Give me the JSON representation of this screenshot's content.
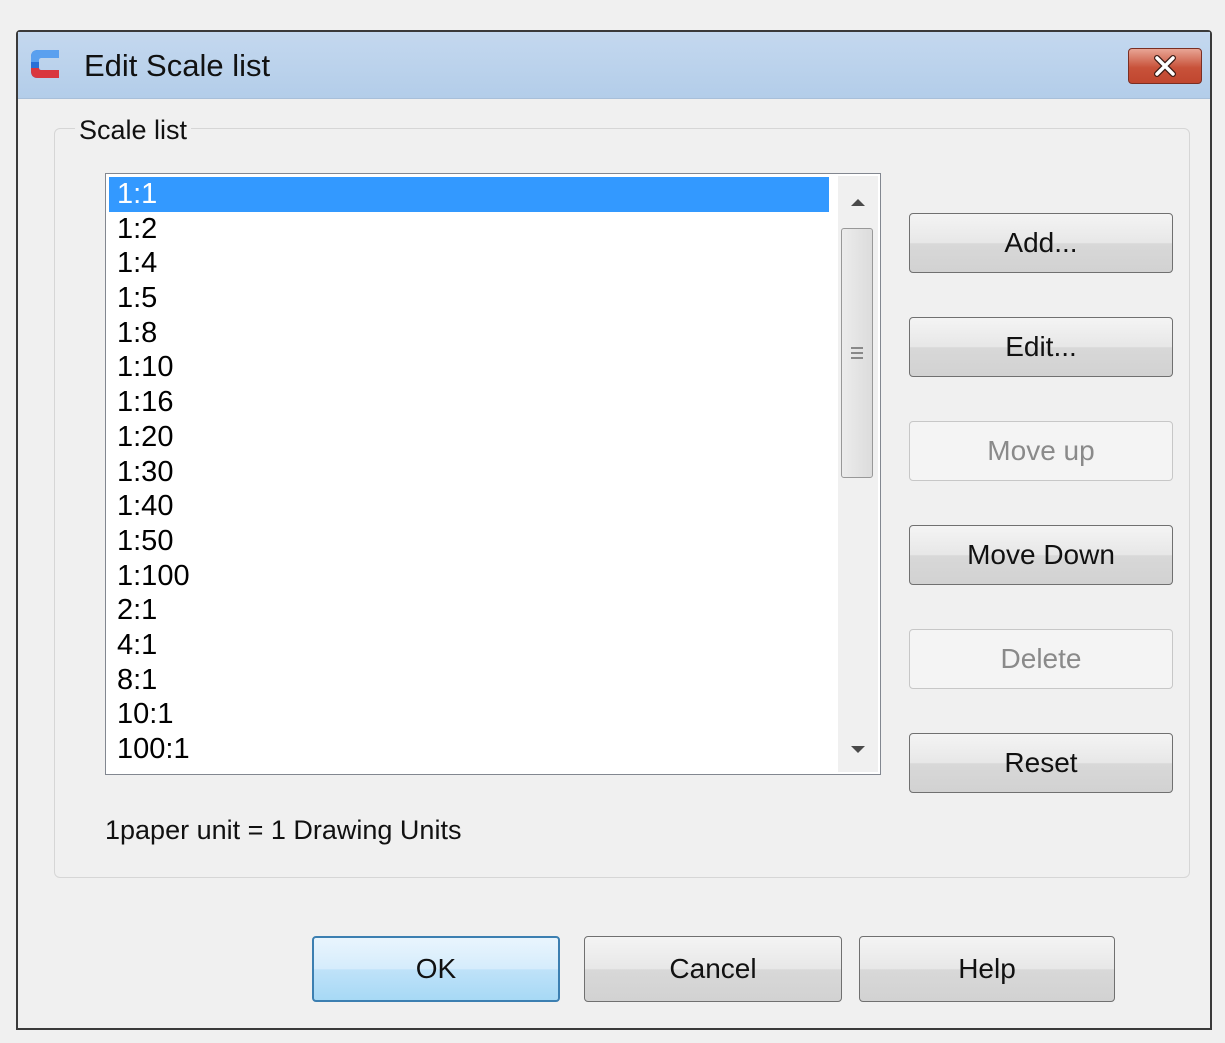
{
  "window": {
    "title": "Edit Scale list",
    "icon": "gcad-logo-icon",
    "close_icon": "close-icon"
  },
  "group": {
    "label": "Scale list"
  },
  "scale_list": {
    "items": [
      "1:1",
      "1:2",
      "1:4",
      "1:5",
      "1:8",
      "1:10",
      "1:16",
      "1:20",
      "1:30",
      "1:40",
      "1:50",
      "1:100",
      "2:1",
      "4:1",
      "8:1",
      "10:1",
      "100:1"
    ],
    "selected": "1:1"
  },
  "buttons": {
    "add": "Add...",
    "edit": "Edit...",
    "move_up": "Move up",
    "move_down": "Move Down",
    "delete": "Delete",
    "reset": "Reset"
  },
  "info": "1paper unit = 1 Drawing Units",
  "footer": {
    "ok": "OK",
    "cancel": "Cancel",
    "help": "Help"
  },
  "colors": {
    "selection": "#3399ff",
    "titlebar": "#b9d1ea",
    "close_button": "#c8523a"
  }
}
